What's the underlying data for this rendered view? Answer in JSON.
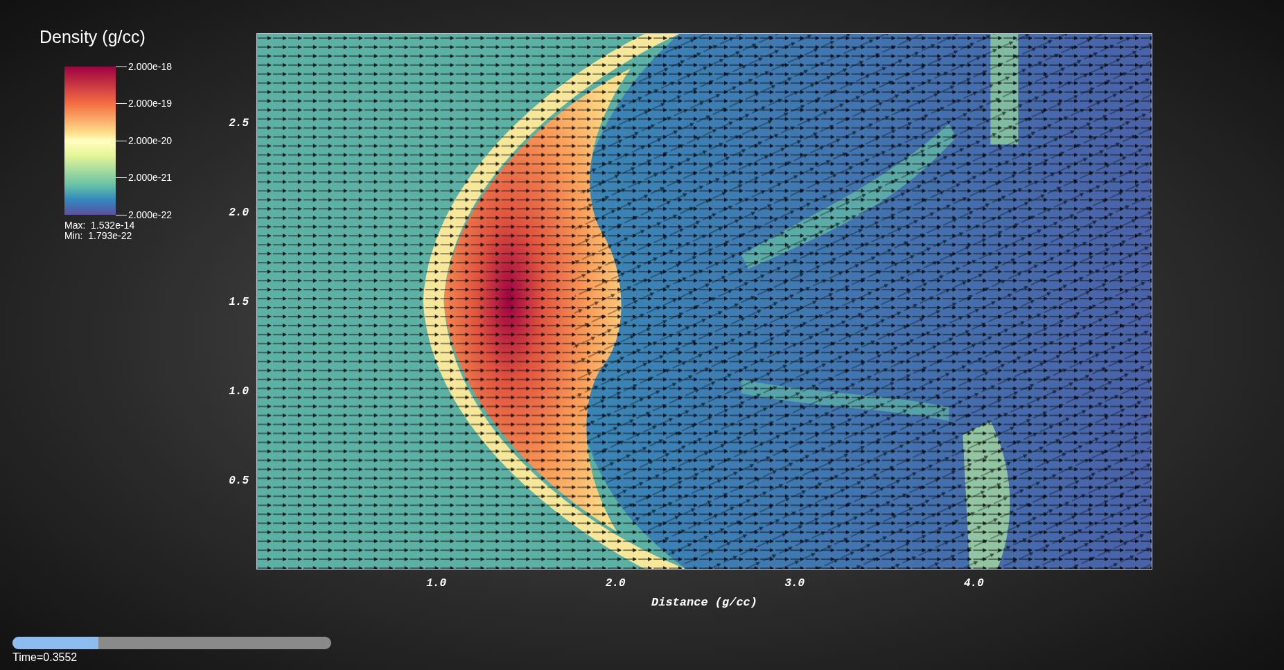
{
  "legend": {
    "title": "Density (g/cc)",
    "ticks": [
      "2.000e-18",
      "2.000e-19",
      "2.000e-20",
      "2.000e-21",
      "2.000e-22"
    ],
    "max": "Max:  1.532e-14",
    "min": "Min:  1.793e-22"
  },
  "plot": {
    "x_ticks": [
      "1.0",
      "2.0",
      "3.0",
      "4.0"
    ],
    "y_ticks": [
      "2.5",
      "2.0",
      "1.5",
      "1.0",
      "0.5"
    ],
    "x_label": "Distance (g/cc)"
  },
  "time_slider": {
    "level": 0.27,
    "label": "Time=0.3552"
  }
}
